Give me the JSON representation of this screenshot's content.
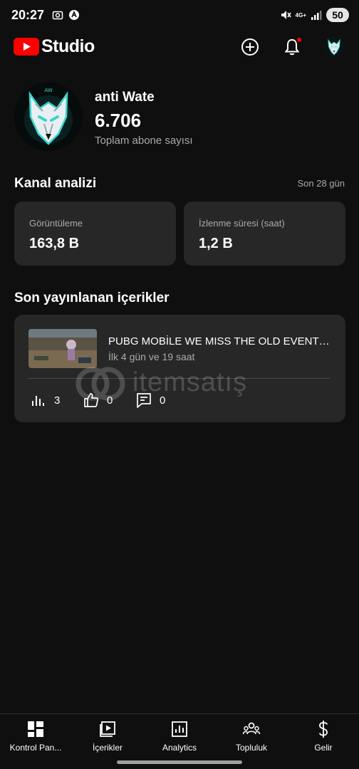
{
  "status_bar": {
    "time": "20:27",
    "network": "4G+",
    "battery": "50"
  },
  "app_bar": {
    "logo_text": "Studio",
    "icons": [
      "youtube-logo-icon",
      "create-icon",
      "notifications-icon",
      "avatar"
    ]
  },
  "channel": {
    "name": "anti Wate",
    "subscribers": "6.706",
    "subscribers_label": "Toplam abone sayısı"
  },
  "analytics": {
    "title": "Kanal analizi",
    "period": "Son 28 gün",
    "cards": [
      {
        "label": "Görüntüleme",
        "value": "163,8 B"
      },
      {
        "label": "İzlenme süresi (saat)",
        "value": "1,2 B"
      }
    ]
  },
  "recent": {
    "title": "Son yayınlanan içerikler",
    "video": {
      "title": "PUBG MOBİLE WE MISS THE OLD EVENTS...",
      "meta": "İlk 4 gün ve 19 saat",
      "views": "3",
      "likes": "0",
      "comments": "0"
    }
  },
  "watermark": {
    "text": "itemsatış"
  },
  "bottom_nav": {
    "items": [
      {
        "label": "Kontrol Pan...",
        "icon": "dashboard-icon"
      },
      {
        "label": "İçerikler",
        "icon": "content-icon"
      },
      {
        "label": "Analytics",
        "icon": "analytics-icon"
      },
      {
        "label": "Topluluk",
        "icon": "community-icon"
      },
      {
        "label": "Gelir",
        "icon": "earn-icon"
      }
    ]
  },
  "colors": {
    "background": "#0f0f0f",
    "card": "#272727",
    "secondary_text": "#aaaaaa",
    "brand_red": "#ff0000",
    "accent_teal": "#36d6cc"
  }
}
